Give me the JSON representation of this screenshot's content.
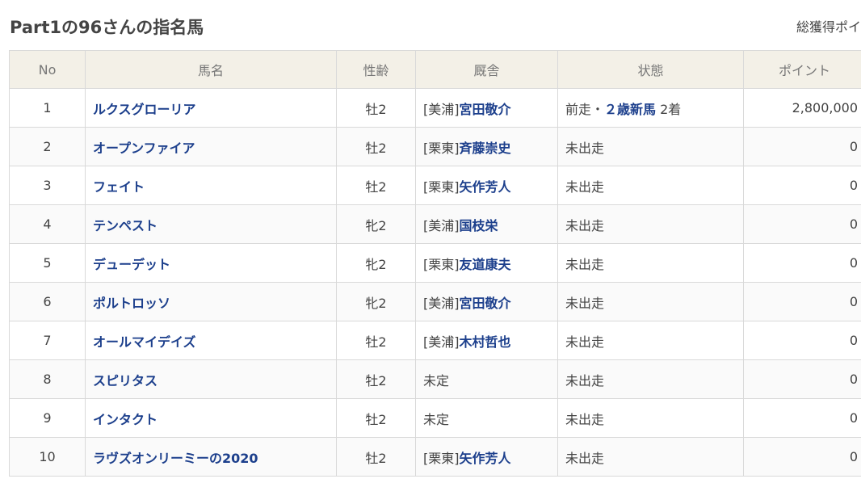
{
  "header": {
    "title": "Part1の96さんの指名馬",
    "total_label": "総獲得ポイ"
  },
  "table": {
    "columns": [
      "No",
      "馬名",
      "性齢",
      "厩舎",
      "状態",
      "ポイント"
    ],
    "rows": [
      {
        "no": "1",
        "name": "ルクスグローリア",
        "sex_age": "牡2",
        "region": "[美浦]",
        "trainer": "宮田敬介",
        "status_prefix": "前走・",
        "status_race": "２歳新馬",
        "status_suffix": " 2着",
        "points": "2,800,000"
      },
      {
        "no": "2",
        "name": "オープンファイア",
        "sex_age": "牡2",
        "region": "[栗東]",
        "trainer": "斉藤崇史",
        "status_prefix": "未出走",
        "status_race": "",
        "status_suffix": "",
        "points": "0"
      },
      {
        "no": "3",
        "name": "フェイト",
        "sex_age": "牡2",
        "region": "[栗東]",
        "trainer": "矢作芳人",
        "status_prefix": "未出走",
        "status_race": "",
        "status_suffix": "",
        "points": "0"
      },
      {
        "no": "4",
        "name": "テンペスト",
        "sex_age": "牝2",
        "region": "[美浦]",
        "trainer": "国枝栄",
        "status_prefix": "未出走",
        "status_race": "",
        "status_suffix": "",
        "points": "0"
      },
      {
        "no": "5",
        "name": "デューデット",
        "sex_age": "牝2",
        "region": "[栗東]",
        "trainer": "友道康夫",
        "status_prefix": "未出走",
        "status_race": "",
        "status_suffix": "",
        "points": "0"
      },
      {
        "no": "6",
        "name": "ポルトロッソ",
        "sex_age": "牝2",
        "region": "[美浦]",
        "trainer": "宮田敬介",
        "status_prefix": "未出走",
        "status_race": "",
        "status_suffix": "",
        "points": "0"
      },
      {
        "no": "7",
        "name": "オールマイデイズ",
        "sex_age": "牡2",
        "region": "[美浦]",
        "trainer": "木村哲也",
        "status_prefix": "未出走",
        "status_race": "",
        "status_suffix": "",
        "points": "0"
      },
      {
        "no": "8",
        "name": "スピリタス",
        "sex_age": "牡2",
        "region": "未定",
        "trainer": "",
        "status_prefix": "未出走",
        "status_race": "",
        "status_suffix": "",
        "points": "0"
      },
      {
        "no": "9",
        "name": "インタクト",
        "sex_age": "牡2",
        "region": "未定",
        "trainer": "",
        "status_prefix": "未出走",
        "status_race": "",
        "status_suffix": "",
        "points": "0"
      },
      {
        "no": "10",
        "name": "ラヴズオンリーミーの2020",
        "sex_age": "牡2",
        "region": "[栗東]",
        "trainer": "矢作芳人",
        "status_prefix": "未出走",
        "status_race": "",
        "status_suffix": "",
        "points": "0"
      }
    ]
  }
}
